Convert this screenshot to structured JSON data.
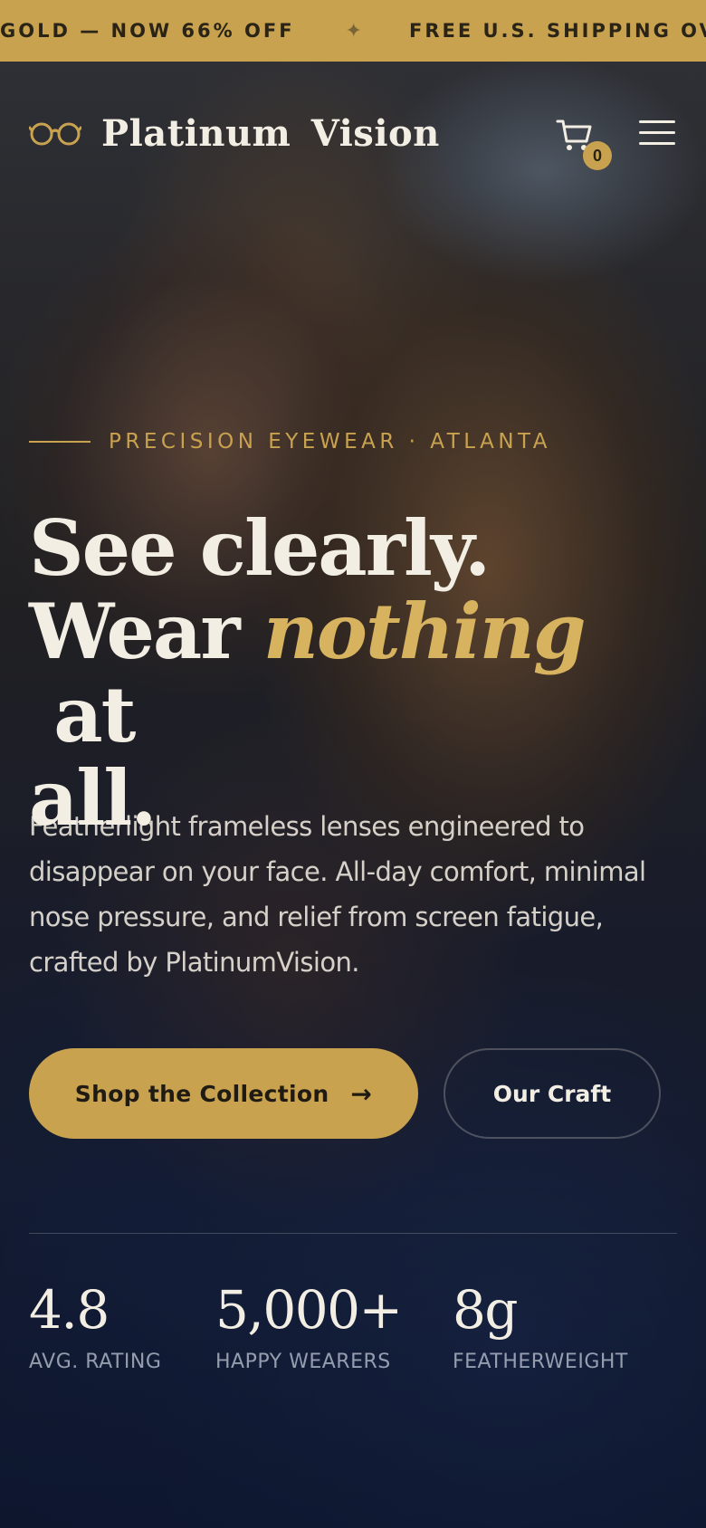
{
  "colors": {
    "accent": "#c9a24f",
    "text_light": "#f3eee3",
    "ticker_text": "#2a2417"
  },
  "ticker": {
    "items": [
      "GOLD — NOW 66% OFF",
      "FREE U.S. SHIPPING OV"
    ],
    "separator_icon": "four-point-star-icon",
    "separator": "✦"
  },
  "header": {
    "logo_icon": "eyeglasses-icon",
    "logo_text": "Platinum  Vision",
    "cart_icon": "shopping-cart-icon",
    "cart_count": "0",
    "menu_icon": "hamburger-menu-icon"
  },
  "hero": {
    "eyebrow": "PRECISION EYEWEAR · ATLANTA",
    "headline_line1": "See clearly.",
    "headline_line2_start": "Wear ",
    "headline_line2_accent": "nothing",
    "headline_line2_end": " at",
    "headline_line3": "all.",
    "lead": "Featherlight frameless lenses engineered to disappear on your face. All-day comfort, minimal nose pressure, and relief from screen fatigue, crafted by PlatinumVision.",
    "primary_cta": "Shop the Collection",
    "primary_cta_icon": "arrow-right-icon",
    "primary_cta_arrow": "→",
    "secondary_cta": "Our Craft"
  },
  "stats": [
    {
      "value": "4.8",
      "label": "AVG. RATING"
    },
    {
      "value": "5,000+",
      "label": "HAPPY WEARERS"
    },
    {
      "value": "8g",
      "label": "FEATHERWEIGHT"
    }
  ]
}
